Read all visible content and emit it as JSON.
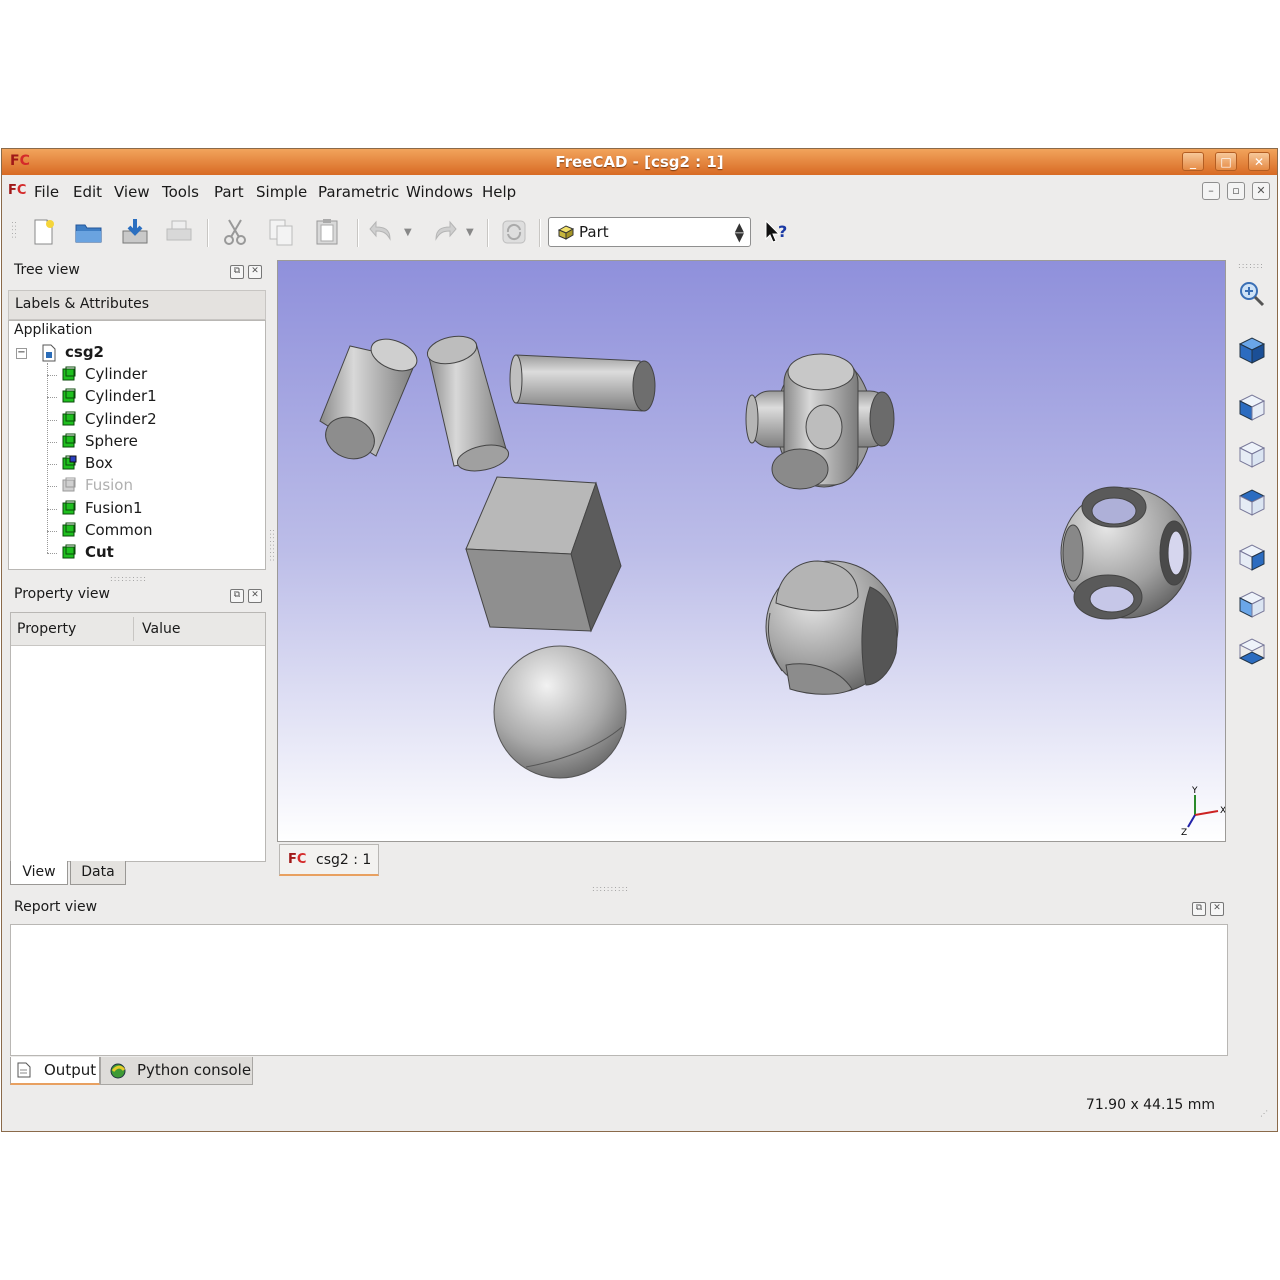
{
  "window": {
    "title": "FreeCAD - [csg2 : 1]"
  },
  "menu": [
    "File",
    "Edit",
    "View",
    "Tools",
    "Part",
    "Simple",
    "Parametric",
    "Windows",
    "Help"
  ],
  "toolbar": {
    "workbench_selected": "Part"
  },
  "tree_view": {
    "title": "Tree view",
    "tab_label": "Labels & Attributes",
    "root": "Applikation",
    "document": "csg2",
    "items": [
      {
        "label": "Cylinder",
        "state": "normal"
      },
      {
        "label": "Cylinder1",
        "state": "normal"
      },
      {
        "label": "Cylinder2",
        "state": "normal"
      },
      {
        "label": "Sphere",
        "state": "normal"
      },
      {
        "label": "Box",
        "state": "normal"
      },
      {
        "label": "Fusion",
        "state": "hidden"
      },
      {
        "label": "Fusion1",
        "state": "normal"
      },
      {
        "label": "Common",
        "state": "normal"
      },
      {
        "label": "Cut",
        "state": "bold"
      }
    ]
  },
  "property_view": {
    "title": "Property view",
    "col_property": "Property",
    "col_value": "Value",
    "tabs": [
      "View",
      "Data"
    ]
  },
  "viewer": {
    "doc_tab": "csg2 : 1",
    "axis_x": "X",
    "axis_y": "Y",
    "axis_z": "Z"
  },
  "report_view": {
    "title": "Report view",
    "tabs": [
      "Output",
      "Python console"
    ]
  },
  "status": {
    "dimensions": "71.90 x 44.15 mm"
  },
  "colors": {
    "titlebar": "#e07a30",
    "tree_icon_green": "#1fc01f",
    "viewer_top": "#8f90db",
    "viewer_bottom": "#ffffff"
  }
}
